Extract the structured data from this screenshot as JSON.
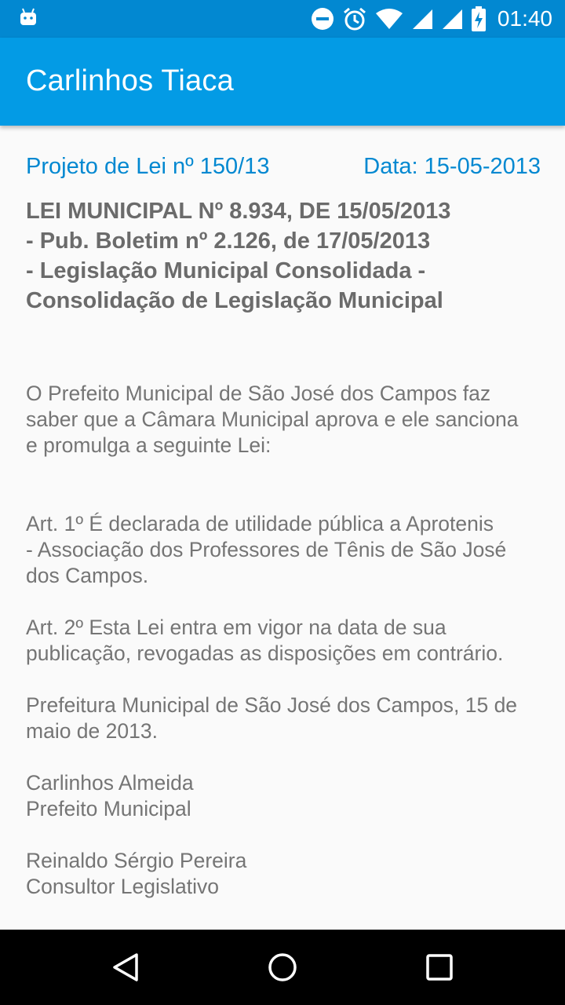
{
  "status_bar": {
    "time": "01:40",
    "icons": [
      "android-icon",
      "do-not-disturb-icon",
      "alarm-icon",
      "wifi-icon",
      "signal-icon",
      "signal-icon-2",
      "battery-charging-icon"
    ]
  },
  "app_bar": {
    "title": "Carlinhos Tiaca"
  },
  "document": {
    "project_label": "Projeto de Lei nº 150/13",
    "date_label": "Data: 15-05-2013",
    "title_lines": [
      "LEI MUNICIPAL Nº 8.934, DE 15/05/2013",
      "- Pub. Boletim nº 2.126, de 17/05/2013",
      "- Legislação Municipal Consolidada -",
      "Consolidação de Legislação Municipal"
    ],
    "intro": [
      "O Prefeito Municipal de São José dos Campos faz",
      "saber que a Câmara Municipal aprova e ele sanciona",
      "e promulga a seguinte Lei:"
    ],
    "art1": [
      "Art. 1º É declarada de utilidade pública a Aprotenis",
      "- Associação dos Professores de Tênis de São José",
      "dos Campos."
    ],
    "art2": [
      "Art. 2º Esta Lei entra em vigor na data de sua",
      "publicação, revogadas as disposições em contrário."
    ],
    "closing": [
      "Prefeitura Municipal de São José dos Campos, 15 de",
      "maio de 2013."
    ],
    "signer1": [
      "Carlinhos Almeida",
      "Prefeito Municipal"
    ],
    "signer2": [
      "Reinaldo Sérgio Pereira",
      "Consultor Legislativo"
    ]
  },
  "nav_bar": {
    "buttons": [
      "back-icon",
      "home-icon",
      "recents-icon"
    ]
  },
  "colors": {
    "status_bar": "#0288d1",
    "app_bar": "#039be5",
    "accent_text": "#0288d1",
    "title_text": "#6b6b6b",
    "body_text": "#757575"
  }
}
